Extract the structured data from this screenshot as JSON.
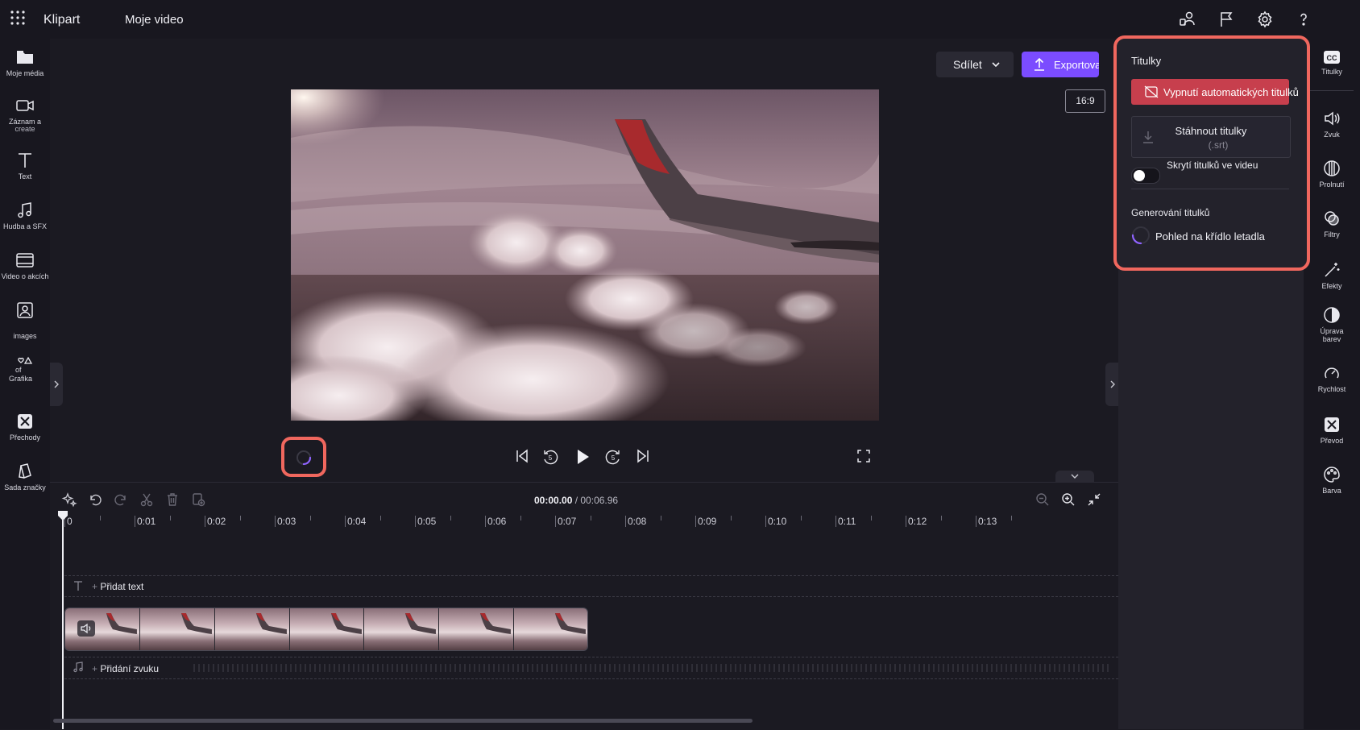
{
  "topbar": {
    "app_name": "Klipart",
    "project_title": "Moje video"
  },
  "left_sidebar": {
    "items": [
      {
        "label": "Moje média"
      },
      {
        "label": "Záznam a"
      },
      {
        "label": "create"
      },
      {
        "label": "Text"
      },
      {
        "label": "Hudba a SFX"
      },
      {
        "label": "Video o akcích"
      },
      {
        "label": "images"
      },
      {
        "label": "of"
      },
      {
        "label": "Grafika"
      },
      {
        "label": "Přechody"
      },
      {
        "label": "Sada značky"
      }
    ]
  },
  "right_sidebar": {
    "items": [
      {
        "label": "Titulky"
      },
      {
        "label": "Zvuk"
      },
      {
        "label": "Prolnutí"
      },
      {
        "label": "Filtry"
      },
      {
        "label": "Efekty"
      },
      {
        "label": "Úprava"
      },
      {
        "label": "barev"
      },
      {
        "label": "Rychlost"
      },
      {
        "label": "Převod"
      },
      {
        "label": "Barva"
      }
    ]
  },
  "preview": {
    "share_label": "Sdílet",
    "export_label": "Exportovat",
    "aspect_ratio": "16:9"
  },
  "captions_panel": {
    "title": "Titulky",
    "auto_off_label": "Vypnutí automatických titulků",
    "download_label": "Stáhnout titulky",
    "download_format": "(.srt)",
    "hide_label": "Skrytí titulků ve videu",
    "hide_enabled": false,
    "generating_heading": "Generování titulků",
    "generating_item": "Pohled na křídlo letadla"
  },
  "timeline": {
    "current_time": "00:00.00",
    "total_time": "/ 00:06.96",
    "ruler": [
      "0",
      "0:01",
      "0:02",
      "0:03",
      "0:04",
      "0:05",
      "0:06",
      "0:07",
      "0:08",
      "0:09",
      "0:10",
      "0:11",
      "0:12",
      "0:13"
    ],
    "add_text_label": "Přidat text",
    "add_audio_label": "Přidání zvuku"
  },
  "colors": {
    "accent": "#7b4cff",
    "highlight": "#f0675e",
    "danger_button": "#c73f4d"
  }
}
